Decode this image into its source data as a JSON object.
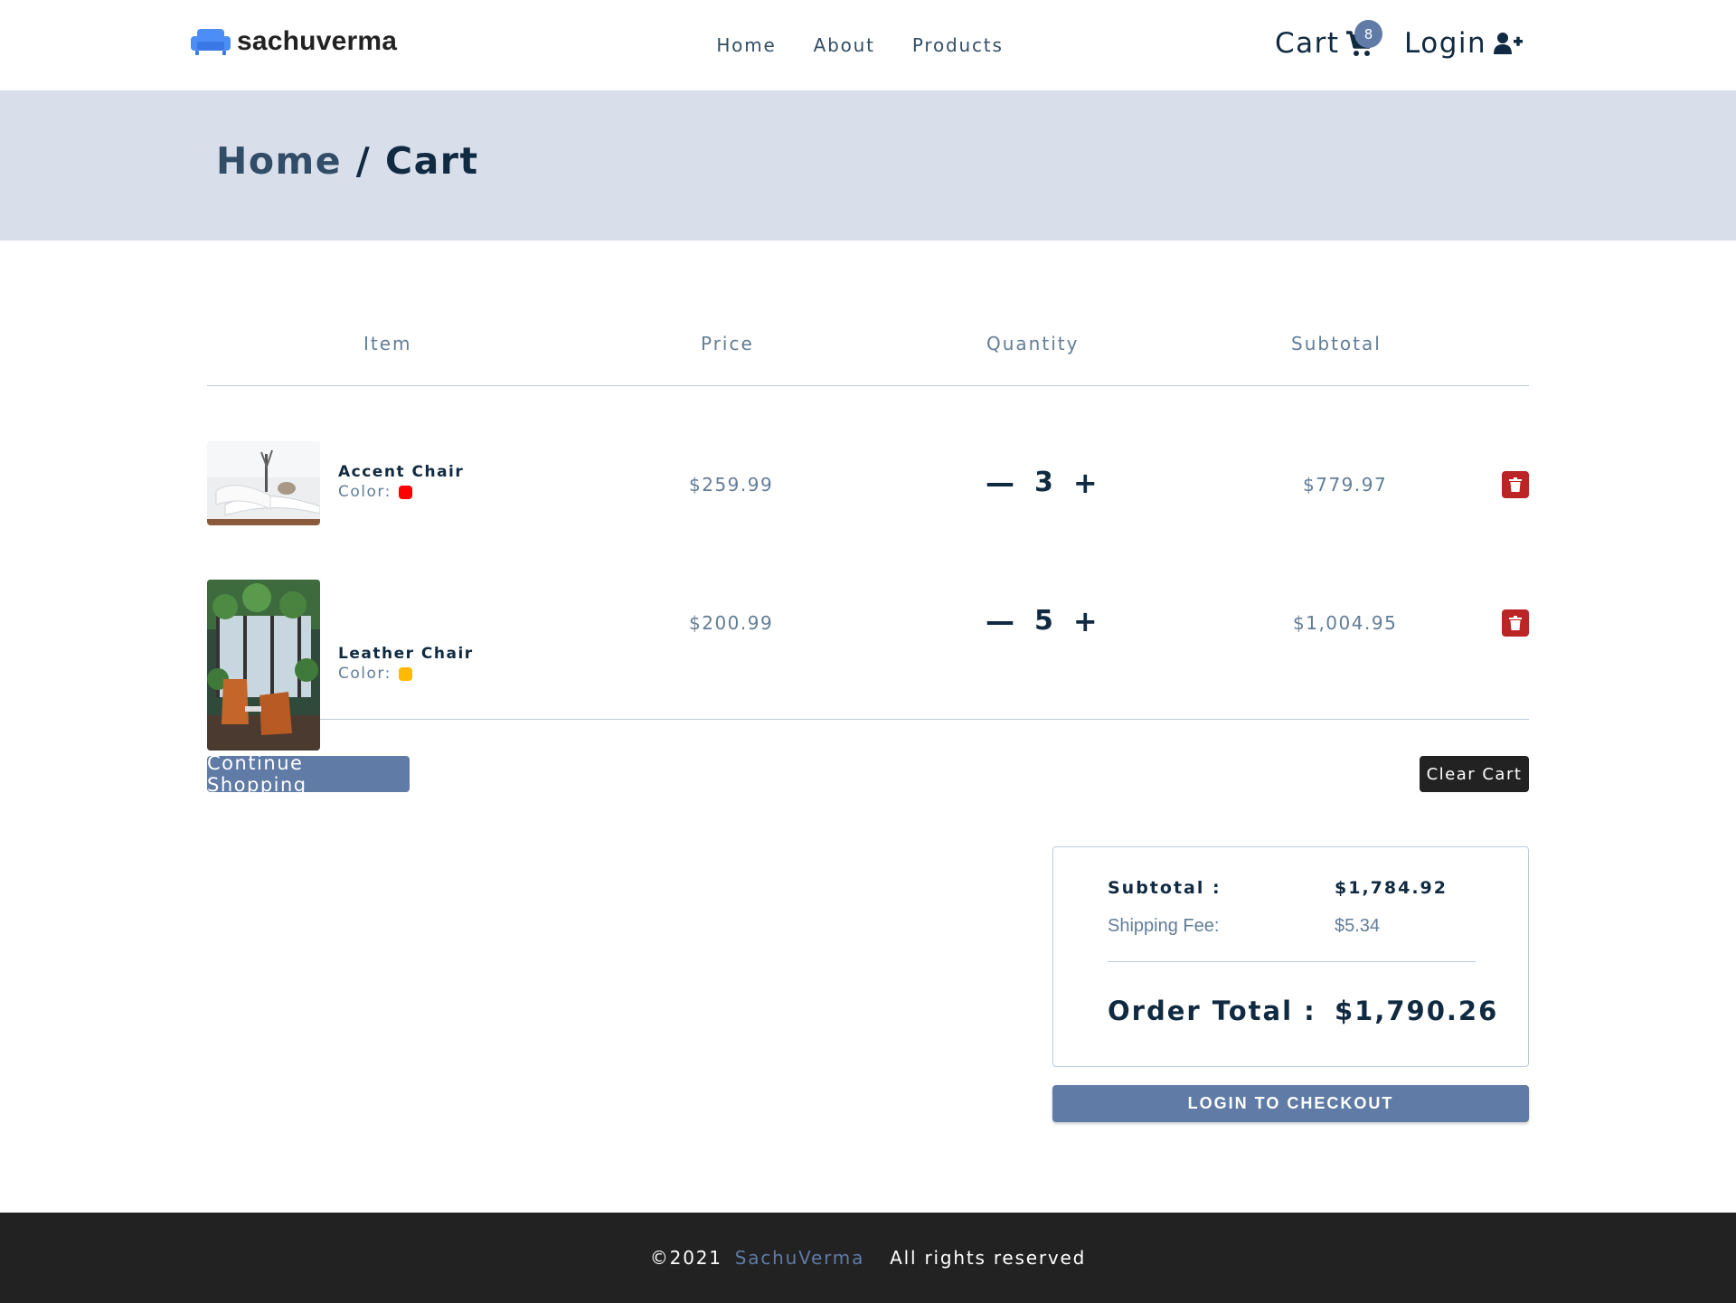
{
  "nav": {
    "logo_text": "sachuverma",
    "links": [
      "Home",
      "About",
      "Products"
    ],
    "cart_label": "Cart",
    "cart_count": "8",
    "login_label": "Login"
  },
  "hero": {
    "home": "Home",
    "separator": " / ",
    "current": "Cart"
  },
  "columns": {
    "item": "Item",
    "price": "Price",
    "quantity": "Quantity",
    "subtotal": "Subtotal"
  },
  "items": [
    {
      "name": "Accent Chair",
      "color_label": "Color:",
      "color": "#ff0000",
      "price": "$259.99",
      "qty": "3",
      "subtotal": "$779.97"
    },
    {
      "name": "Leather Chair",
      "color_label": "Color:",
      "color": "#ffb900",
      "price": "$200.99",
      "qty": "5",
      "subtotal": "$1,004.95"
    }
  ],
  "buttons": {
    "continue": "Continue Shopping",
    "clear": "Clear Cart",
    "checkout": "LOGIN TO CHECKOUT"
  },
  "totals": {
    "subtotal_label": "Subtotal :",
    "subtotal": "$1,784.92",
    "shipping_label": "Shipping Fee:",
    "shipping": "$5.34",
    "order_label": "Order Total :",
    "order_total": "$1,790.26"
  },
  "footer": {
    "copyright": "©2021",
    "brand": "SachuVerma",
    "rights": "All rights reserved"
  },
  "colors": {
    "primary": "#5f7ba6",
    "hero_bg": "#d9dfea",
    "danger": "#bb2525",
    "dark": "#222222"
  },
  "icons": {
    "logo": "sofa-icon",
    "cart": "shopping-cart-icon",
    "login": "user-plus-icon",
    "remove": "trash-icon"
  }
}
